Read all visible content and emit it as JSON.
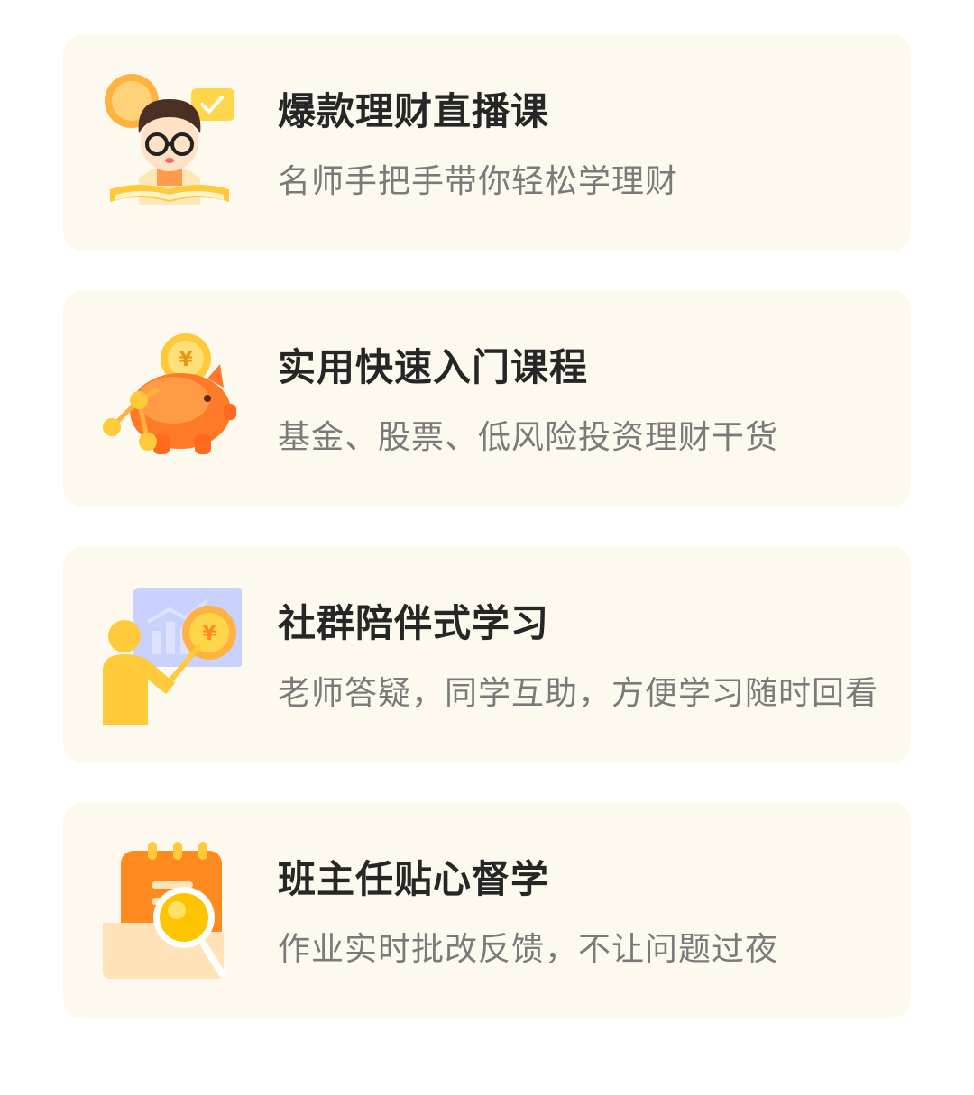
{
  "features": [
    {
      "title": "爆款理财直播课",
      "subtitle": "名师手把手带你轻松学理财",
      "icon": "teacher-with-book-icon"
    },
    {
      "title": "实用快速入门课程",
      "subtitle": "基金、股票、低风险投资理财干货",
      "icon": "piggy-bank-icon"
    },
    {
      "title": "社群陪伴式学习",
      "subtitle": "老师答疑，同学互助，方便学习随时回看",
      "icon": "presentation-chart-icon"
    },
    {
      "title": "班主任贴心督学",
      "subtitle": "作业实时批改反馈，不让问题过夜",
      "icon": "calendar-magnifier-icon"
    }
  ],
  "colors": {
    "card_background": "#fdf9ee",
    "title_text": "#262626",
    "subtitle_text": "#7a7a7a",
    "accent_orange": "#ff8a1f",
    "accent_yellow": "#ffc93a"
  }
}
